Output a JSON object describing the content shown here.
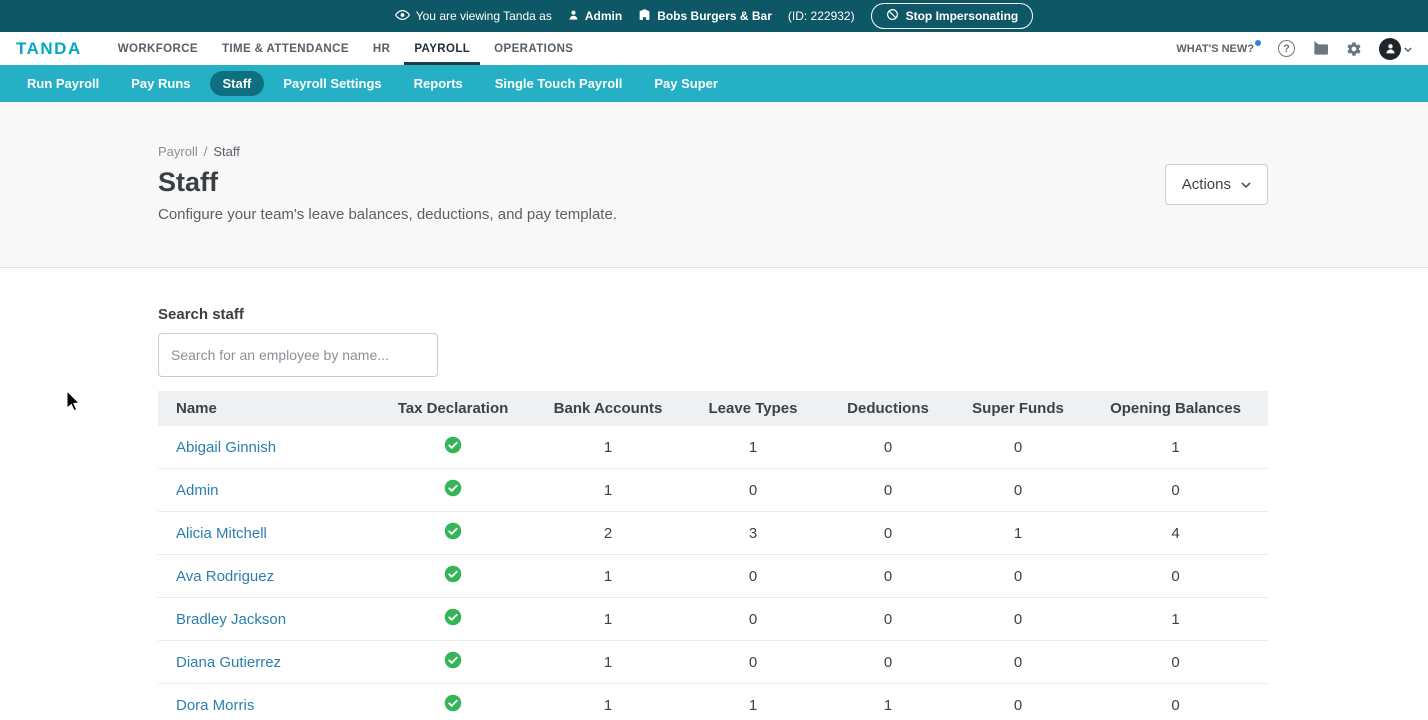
{
  "colors": {
    "topbar_bg": "#0d5766",
    "brand_teal": "#00a9c0",
    "subnav_bg": "#25b0c5",
    "subnav_active_bg": "#0e6f80",
    "link_blue": "#2b7fb0",
    "success_green": "#35b558"
  },
  "impersonation_bar": {
    "message": "You are viewing Tanda as",
    "user_label": "Admin",
    "org_label": "Bobs Burgers & Bar",
    "org_id": "(ID: 222932)",
    "stop_button_label": "Stop Impersonating"
  },
  "navbar": {
    "logo_text": "TANDA",
    "items": [
      {
        "label": "WORKFORCE",
        "active": false
      },
      {
        "label": "TIME & ATTENDANCE",
        "active": false
      },
      {
        "label": "HR",
        "active": false
      },
      {
        "label": "PAYROLL",
        "active": true
      },
      {
        "label": "OPERATIONS",
        "active": false
      }
    ],
    "whats_new_label": "WHAT'S NEW?"
  },
  "subnav": {
    "items": [
      {
        "label": "Run Payroll",
        "active": false
      },
      {
        "label": "Pay Runs",
        "active": false
      },
      {
        "label": "Staff",
        "active": true
      },
      {
        "label": "Payroll Settings",
        "active": false
      },
      {
        "label": "Reports",
        "active": false
      },
      {
        "label": "Single Touch Payroll",
        "active": false
      },
      {
        "label": "Pay Super",
        "active": false
      }
    ]
  },
  "page": {
    "breadcrumb": {
      "parent": "Payroll",
      "separator": "/",
      "current": "Staff"
    },
    "title": "Staff",
    "subtitle": "Configure your team's leave balances, deductions, and pay template.",
    "actions_button_label": "Actions"
  },
  "search": {
    "label": "Search staff",
    "placeholder": "Search for an employee by name..."
  },
  "table": {
    "columns": [
      "Name",
      "Tax Declaration",
      "Bank Accounts",
      "Leave Types",
      "Deductions",
      "Super Funds",
      "Opening Balances"
    ],
    "rows": [
      {
        "name": "Abigail Ginnish",
        "tax_declaration": "complete",
        "bank_accounts": "1",
        "leave_types": "1",
        "deductions": "0",
        "super_funds": "0",
        "opening_balances": "1"
      },
      {
        "name": "Admin",
        "tax_declaration": "complete",
        "bank_accounts": "1",
        "leave_types": "0",
        "deductions": "0",
        "super_funds": "0",
        "opening_balances": "0"
      },
      {
        "name": "Alicia Mitchell",
        "tax_declaration": "complete",
        "bank_accounts": "2",
        "leave_types": "3",
        "deductions": "0",
        "super_funds": "1",
        "opening_balances": "4"
      },
      {
        "name": "Ava Rodriguez",
        "tax_declaration": "complete",
        "bank_accounts": "1",
        "leave_types": "0",
        "deductions": "0",
        "super_funds": "0",
        "opening_balances": "0"
      },
      {
        "name": "Bradley Jackson",
        "tax_declaration": "complete",
        "bank_accounts": "1",
        "leave_types": "0",
        "deductions": "0",
        "super_funds": "0",
        "opening_balances": "1"
      },
      {
        "name": "Diana Gutierrez",
        "tax_declaration": "complete",
        "bank_accounts": "1",
        "leave_types": "0",
        "deductions": "0",
        "super_funds": "0",
        "opening_balances": "0"
      },
      {
        "name": "Dora Morris",
        "tax_declaration": "complete",
        "bank_accounts": "1",
        "leave_types": "1",
        "deductions": "1",
        "super_funds": "0",
        "opening_balances": "0"
      }
    ]
  }
}
